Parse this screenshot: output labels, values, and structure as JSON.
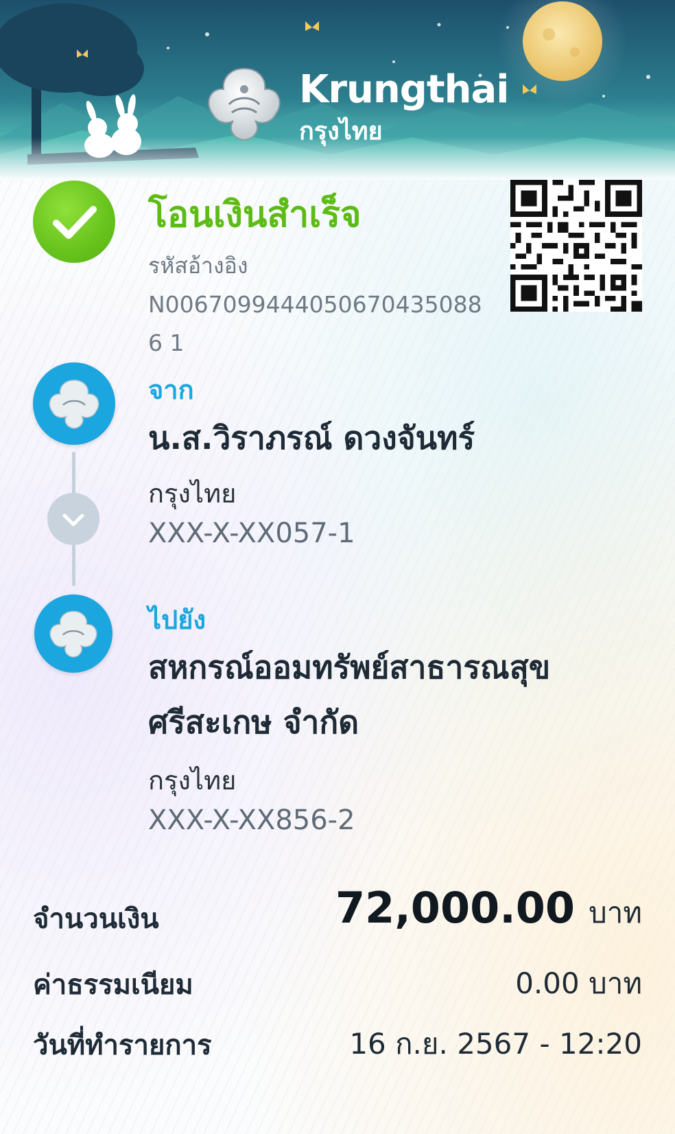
{
  "banner": {
    "brand_en": "Krungthai",
    "brand_th": "กรุงไทย",
    "colors": {
      "sky": "#1f5d78",
      "teal": "#3fb2b0",
      "moon": "#f4d68a"
    }
  },
  "status": {
    "title": "โอนเงินสำเร็จ",
    "icon": "check-icon",
    "color": "#5dbb15",
    "ref_label": "รหัสอ้างอิง",
    "ref_code": "N00670994440506704350886 1"
  },
  "from": {
    "label": "จาก",
    "name": "น.ส.วิราภรณ์ ดวงจันทร์",
    "bank": "กรุงไทย",
    "account": "XXX-X-XX057-1"
  },
  "to": {
    "label": "ไปยัง",
    "name": "สหกรณ์ออมทรัพย์สาธารณสุขศรีสะเกษ จำกัด",
    "bank": "กรุงไทย",
    "account": "XXX-X-XX856-2"
  },
  "summary": {
    "amount_label": "จำนวนเงิน",
    "amount_value": "72,000.00",
    "amount_unit": "บาท",
    "fee_label": "ค่าธรรมเนียม",
    "fee_value": "0.00 บาท",
    "date_label": "วันที่ทำรายการ",
    "date_value": "16 ก.ย. 2567 - 12:20"
  },
  "accent": "#1ba6e0"
}
